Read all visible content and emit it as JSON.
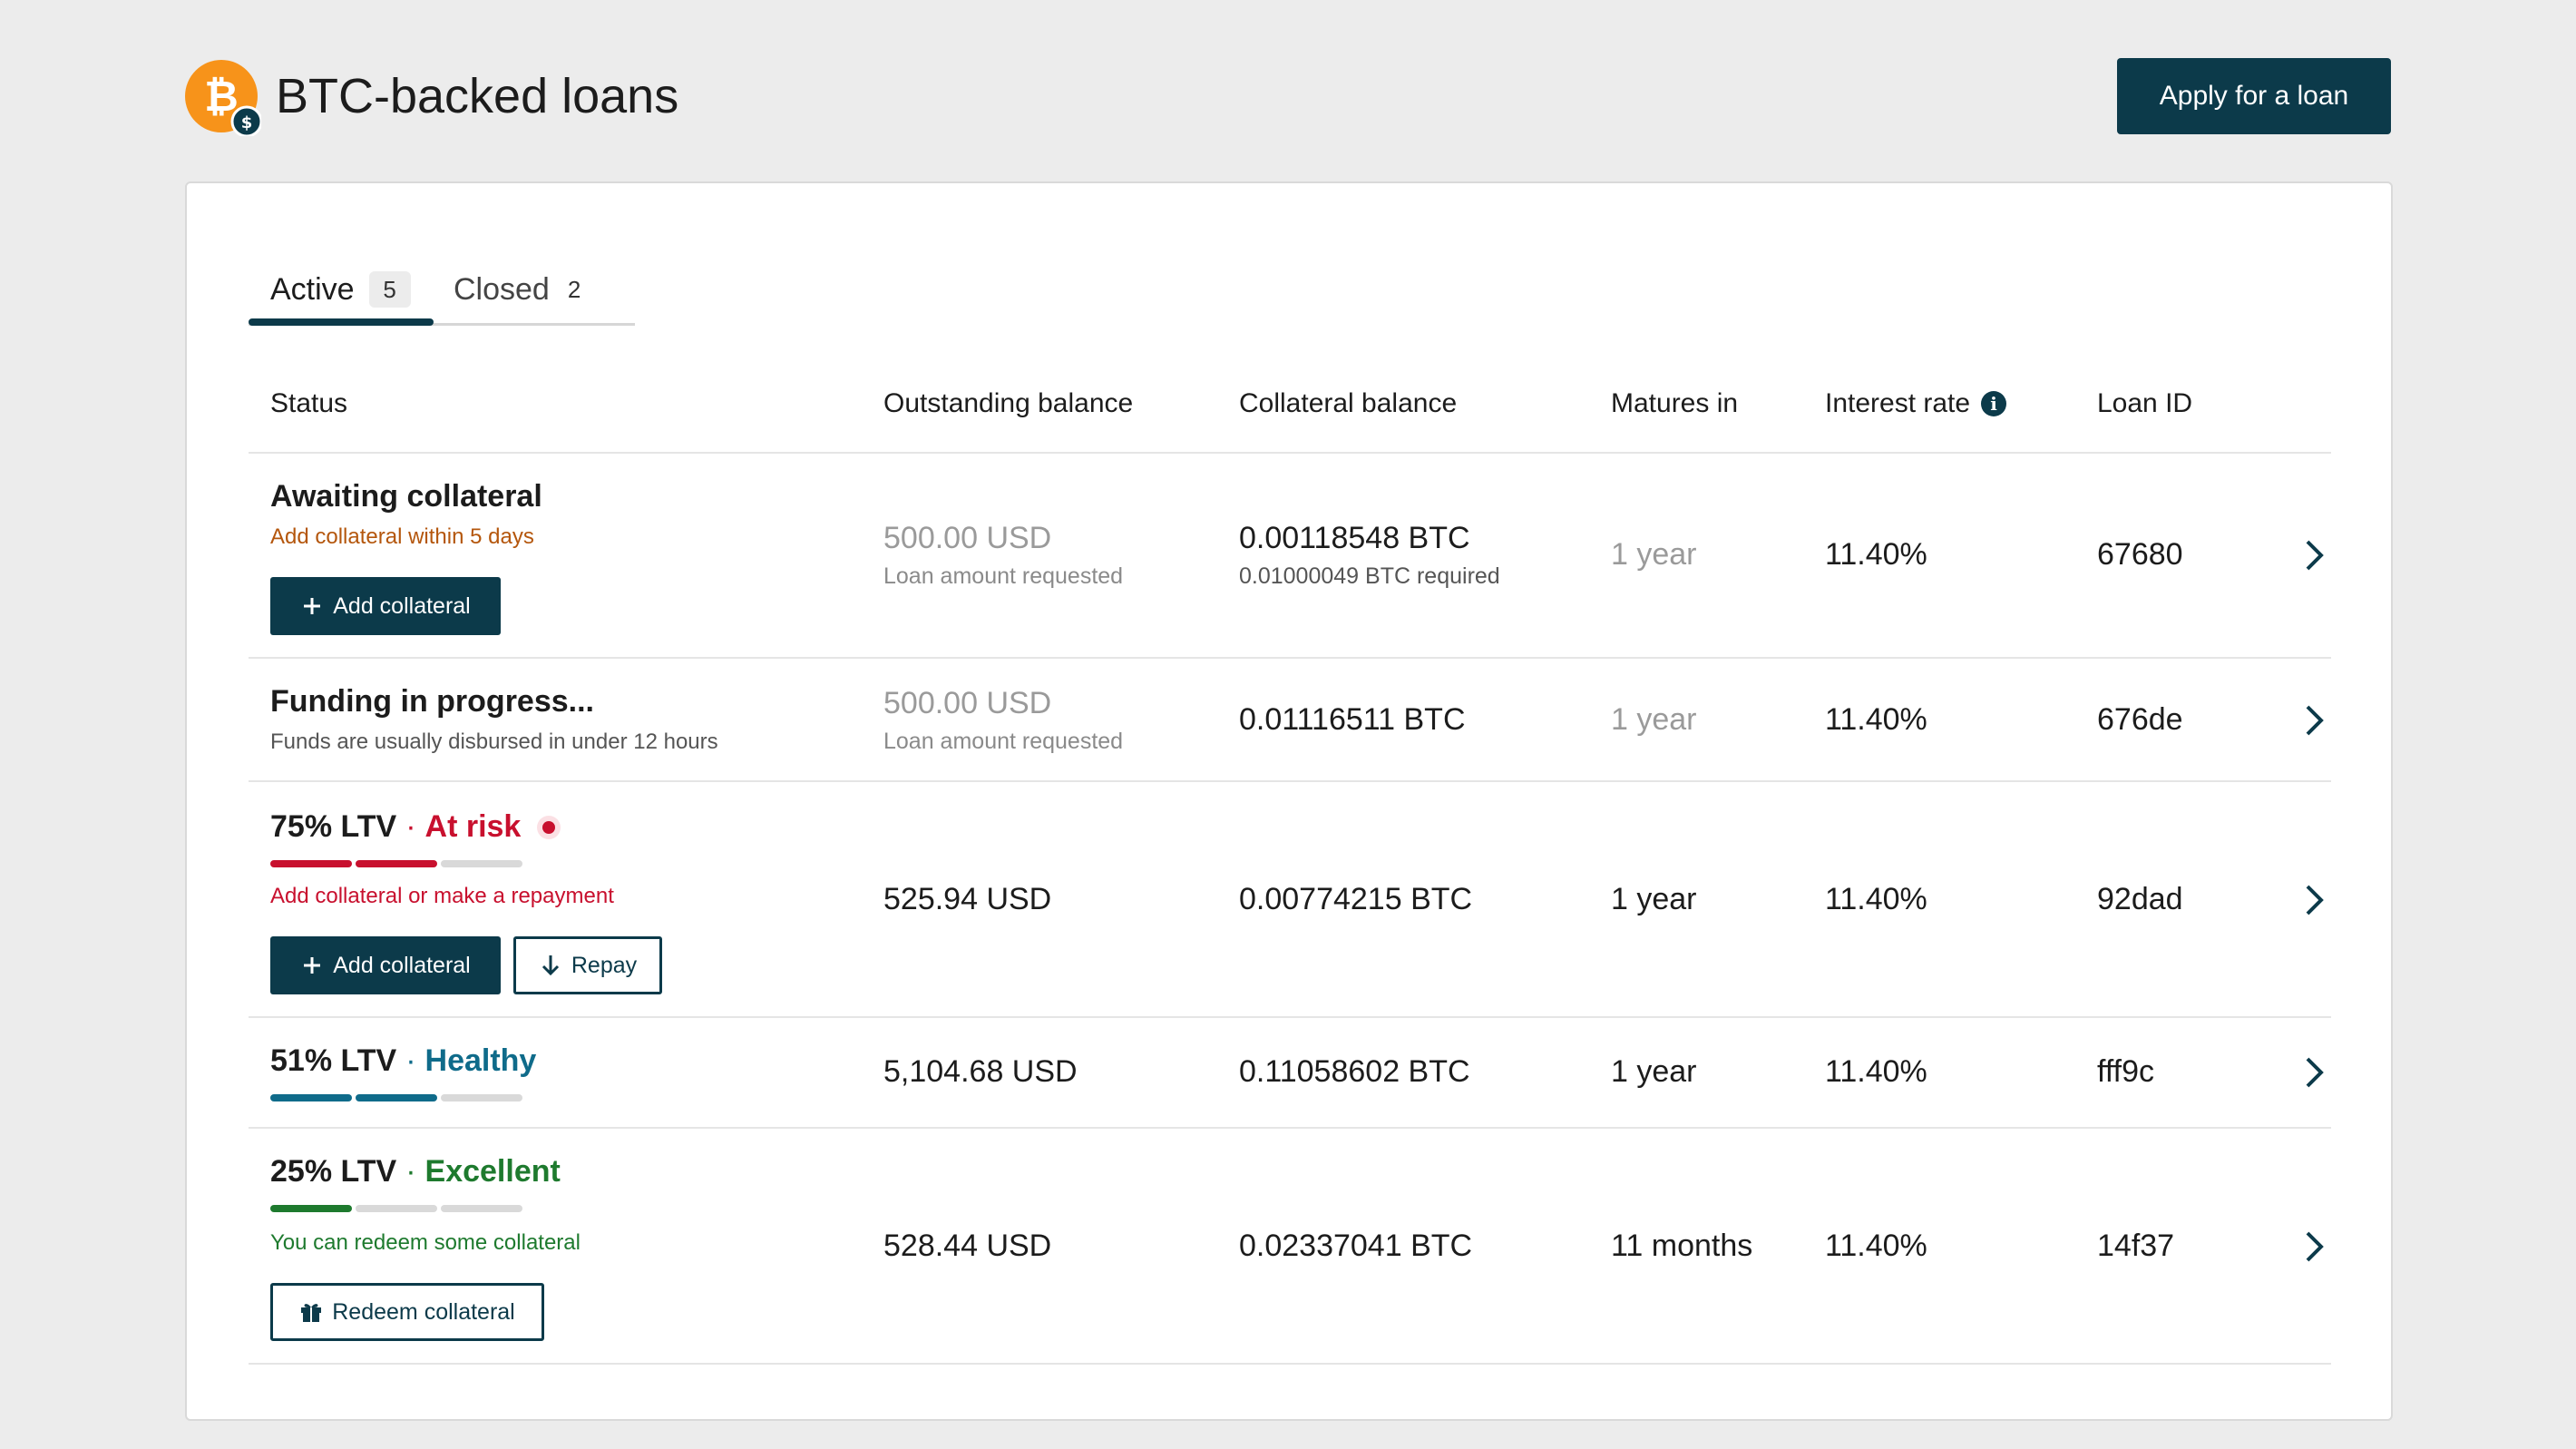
{
  "header": {
    "title": "BTC-backed loans",
    "apply_button": "Apply for a loan",
    "logo_icon": "bitcoin-dollar-icon"
  },
  "colors": {
    "primary": "#0c3a4a",
    "bitcoin_orange": "#f7931a",
    "risk_red": "#c8102e",
    "healthy_teal": "#0f6b8a",
    "excellent_green": "#1e7a2e",
    "awaiting_orange": "#b4560c"
  },
  "tabs": [
    {
      "label": "Active",
      "count": "5",
      "selected": true
    },
    {
      "label": "Closed",
      "count": "2",
      "selected": false
    }
  ],
  "table": {
    "headers": {
      "status": "Status",
      "outstanding": "Outstanding balance",
      "collateral": "Collateral balance",
      "matures": "Matures in",
      "interest": "Interest rate",
      "loan_id": "Loan ID"
    },
    "rows": [
      {
        "status_title": "Awaiting collateral",
        "status_note": "Add collateral within 5 days",
        "outstanding": "500.00 USD",
        "outstanding_sub": "Loan amount requested",
        "collateral": "0.00118548 BTC",
        "collateral_sub": "0.01000049 BTC required",
        "matures": "1 year",
        "interest": "11.40%",
        "loan_id": "67680",
        "buttons": [
          "Add collateral"
        ]
      },
      {
        "status_title": "Funding in progress...",
        "status_note": "Funds are usually disbursed in under 12 hours",
        "outstanding": "500.00 USD",
        "outstanding_sub": "Loan amount requested",
        "collateral": "0.01116511 BTC",
        "matures": "1 year",
        "interest": "11.40%",
        "loan_id": "676de"
      },
      {
        "ltv_label": "75% LTV",
        "separator": "·",
        "ltv_state": "At risk",
        "ltv_fraction": 0.75,
        "status_note": "Add collateral or make a repayment",
        "outstanding": "525.94 USD",
        "collateral": "0.00774215 BTC",
        "matures": "1 year",
        "interest": "11.40%",
        "loan_id": "92dad",
        "buttons": [
          "Add collateral",
          "Repay"
        ]
      },
      {
        "ltv_label": "51% LTV",
        "separator": "·",
        "ltv_state": "Healthy",
        "ltv_fraction": 0.51,
        "outstanding": "5,104.68 USD",
        "collateral": "0.11058602 BTC",
        "matures": "1 year",
        "interest": "11.40%",
        "loan_id": "fff9c"
      },
      {
        "ltv_label": "25% LTV",
        "separator": "·",
        "ltv_state": "Excellent",
        "ltv_fraction": 0.25,
        "status_note": "You can redeem some collateral",
        "outstanding": "528.44 USD",
        "collateral": "0.02337041 BTC",
        "matures": "11 months",
        "interest": "11.40%",
        "loan_id": "14f37",
        "buttons": [
          "Redeem collateral"
        ]
      }
    ]
  }
}
